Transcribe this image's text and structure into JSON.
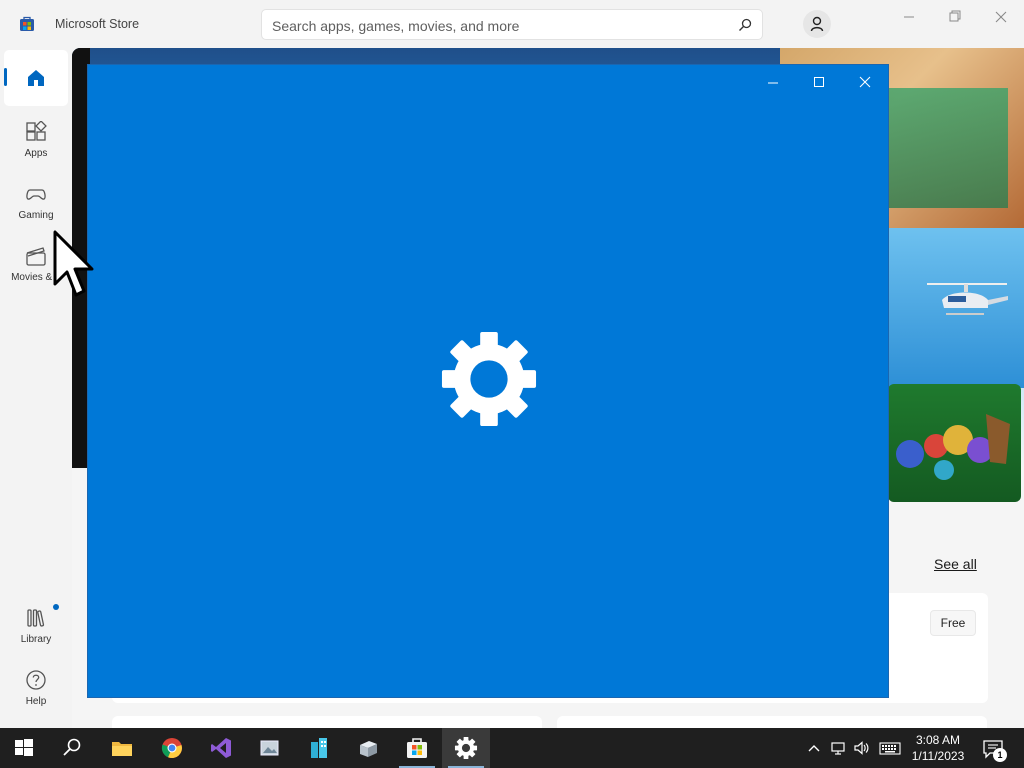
{
  "window": {
    "app_title": "Microsoft Store",
    "search_placeholder": "Search apps, games, movies, and more"
  },
  "nav": {
    "items": [
      {
        "label": "",
        "icon": "home-icon",
        "active": true
      },
      {
        "label": "Apps",
        "icon": "apps-icon"
      },
      {
        "label": "Gaming",
        "icon": "gaming-icon"
      },
      {
        "label": "Movies & T",
        "icon": "movies-icon"
      },
      {
        "label": "Library",
        "icon": "library-icon",
        "badge": true
      },
      {
        "label": "Help",
        "icon": "help-icon"
      }
    ]
  },
  "content": {
    "see_all": "See all",
    "free_label": "Free"
  },
  "splash": {
    "icon": "gear-icon",
    "background": "#0078d7"
  },
  "taskbar": {
    "apps": [
      "start-icon",
      "search-icon",
      "file-explorer-icon",
      "chrome-icon",
      "visual-studio-icon",
      "photos-icon",
      "buildings-icon",
      "package-icon",
      "store-icon",
      "settings-icon"
    ],
    "clock_time": "3:08 AM",
    "clock_date": "1/11/2023",
    "notification_count": "1"
  },
  "colors": {
    "accent": "#0067c0",
    "splash_blue": "#0078d7",
    "taskbar": "#1f1f1f"
  }
}
